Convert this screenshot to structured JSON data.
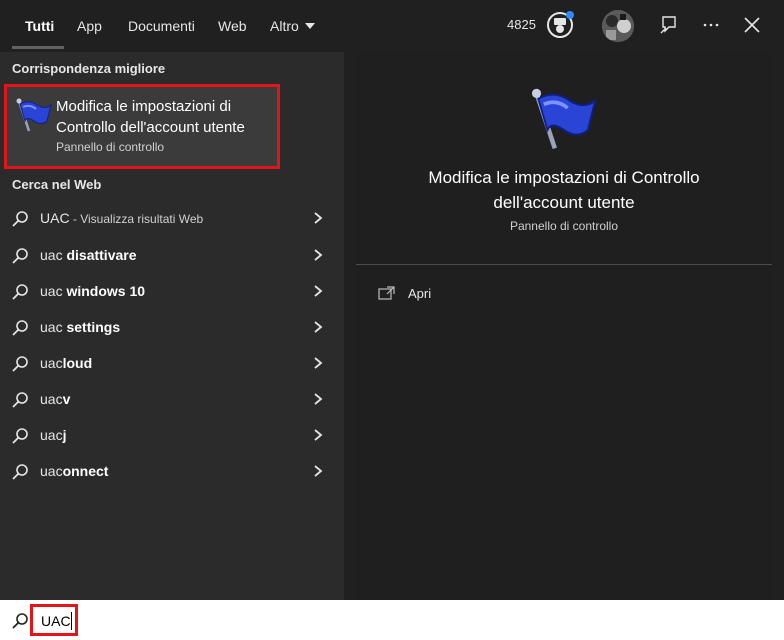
{
  "tabs": [
    {
      "label": "Tutti",
      "active": true
    },
    {
      "label": "App"
    },
    {
      "label": "Documenti"
    },
    {
      "label": "Web"
    },
    {
      "label": "Altro"
    }
  ],
  "header": {
    "points": "4825",
    "medal_icon": "rewards-medal-icon",
    "feedback_icon": "feedback-icon",
    "more_icon": "more-options-icon",
    "close_icon": "close-icon"
  },
  "best_match": {
    "heading": "Corrispondenza migliore",
    "title": "Modifica le impostazioni di Controllo dell'account utente",
    "subtitle": "Pannello di controllo",
    "icon": "uac-flag-icon"
  },
  "web": {
    "heading": "Cerca nel Web",
    "items": [
      {
        "prefix": "UAC",
        "bold": "",
        "hint": " - Visualizza risultati Web"
      },
      {
        "prefix": "uac ",
        "bold": "disattivare",
        "hint": ""
      },
      {
        "prefix": "uac ",
        "bold": "windows 10",
        "hint": ""
      },
      {
        "prefix": "uac ",
        "bold": "settings",
        "hint": ""
      },
      {
        "prefix": "uac",
        "bold": "loud",
        "hint": ""
      },
      {
        "prefix": "uac",
        "bold": "v",
        "hint": ""
      },
      {
        "prefix": "uac",
        "bold": "j",
        "hint": ""
      },
      {
        "prefix": "uac",
        "bold": "onnect",
        "hint": ""
      }
    ]
  },
  "preview": {
    "title": "Modifica le impostazioni di Controllo dell'account utente",
    "subtitle": "Pannello di controllo",
    "action_label": "Apri"
  },
  "search": {
    "value": "UAC"
  },
  "colors": {
    "highlight_border": "#e3151b",
    "flag_blue": "#2a44d6",
    "notification_dot": "#2f8cff"
  }
}
